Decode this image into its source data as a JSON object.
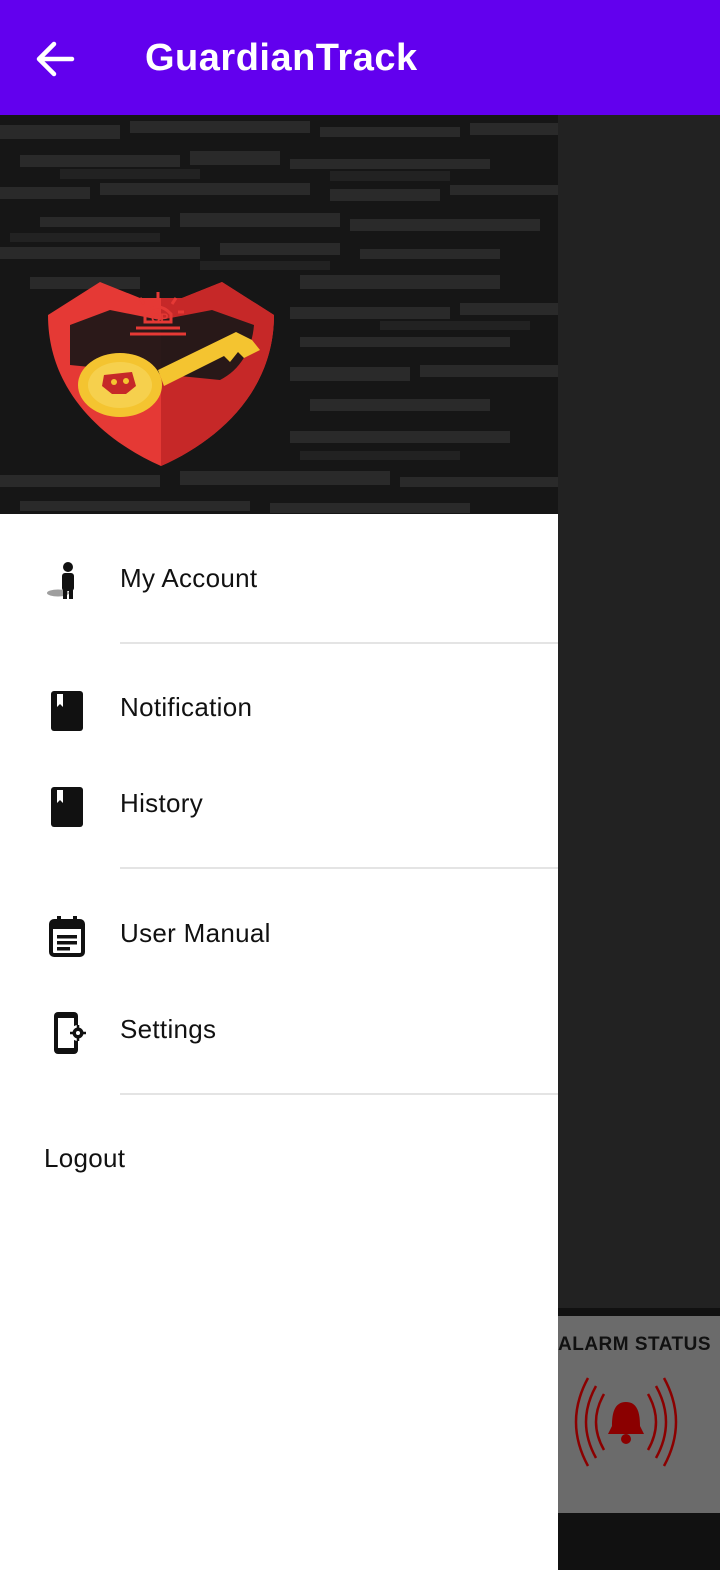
{
  "app_bar": {
    "title": "GuardianTrack",
    "back_icon": "arrow-back-icon"
  },
  "colors": {
    "primary": "#6200EE",
    "scrim": "#222222",
    "logo_red": "#e53935",
    "logo_gold": "#f4c430"
  },
  "drawer": {
    "menu": [
      {
        "label": "My Account",
        "icon": "account-icon"
      },
      {
        "label": "Notification",
        "icon": "book-icon"
      },
      {
        "label": "History",
        "icon": "book-icon"
      },
      {
        "label": "User Manual",
        "icon": "calendar-note-icon"
      },
      {
        "label": "Settings",
        "icon": "device-settings-icon"
      }
    ],
    "logout_label": "Logout"
  },
  "background": {
    "alarm_status_title": "ALARM STATUS",
    "alarm_icon": "alarm-bell-icon"
  }
}
